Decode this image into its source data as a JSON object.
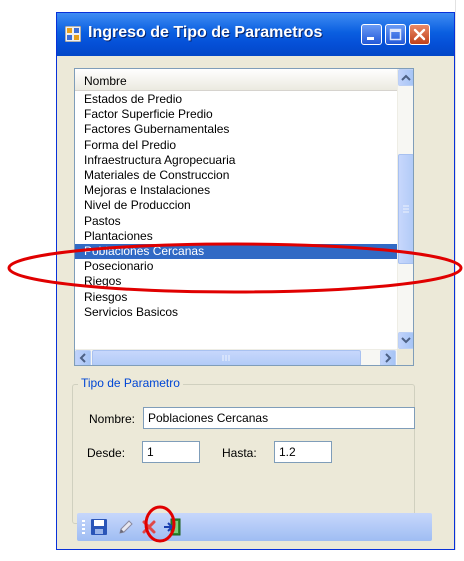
{
  "window": {
    "title": "Ingreso de Tipo de Parametros"
  },
  "list": {
    "column_header": "Nombre",
    "items": [
      "Estados de Predio",
      "Factor Superficie Predio",
      "Factores Gubernamentales",
      "Forma del Predio",
      "Infraestructura Agropecuaria",
      "Materiales de Construccion",
      "Mejoras e Instalaciones",
      "Nivel de Produccion",
      "Pastos",
      "Plantaciones",
      "Poblaciones Cercanas",
      "Posecionario",
      "Riegos",
      "Riesgos",
      "Servicios Basicos"
    ],
    "selected_index": 10
  },
  "form": {
    "group_title": "Tipo de Parametro",
    "nombre_label": "Nombre:",
    "nombre_value": "Poblaciones Cercanas",
    "desde_label": "Desde:",
    "desde_value": "1",
    "hasta_label": "Hasta:",
    "hasta_value": "1.2"
  },
  "toolbar": {
    "icons": [
      "save-icon",
      "edit-icon",
      "delete-icon",
      "exit-icon"
    ]
  },
  "colors": {
    "selection": "#316ac5",
    "annotation": "#e00000",
    "titlebar": "#0550d8"
  }
}
